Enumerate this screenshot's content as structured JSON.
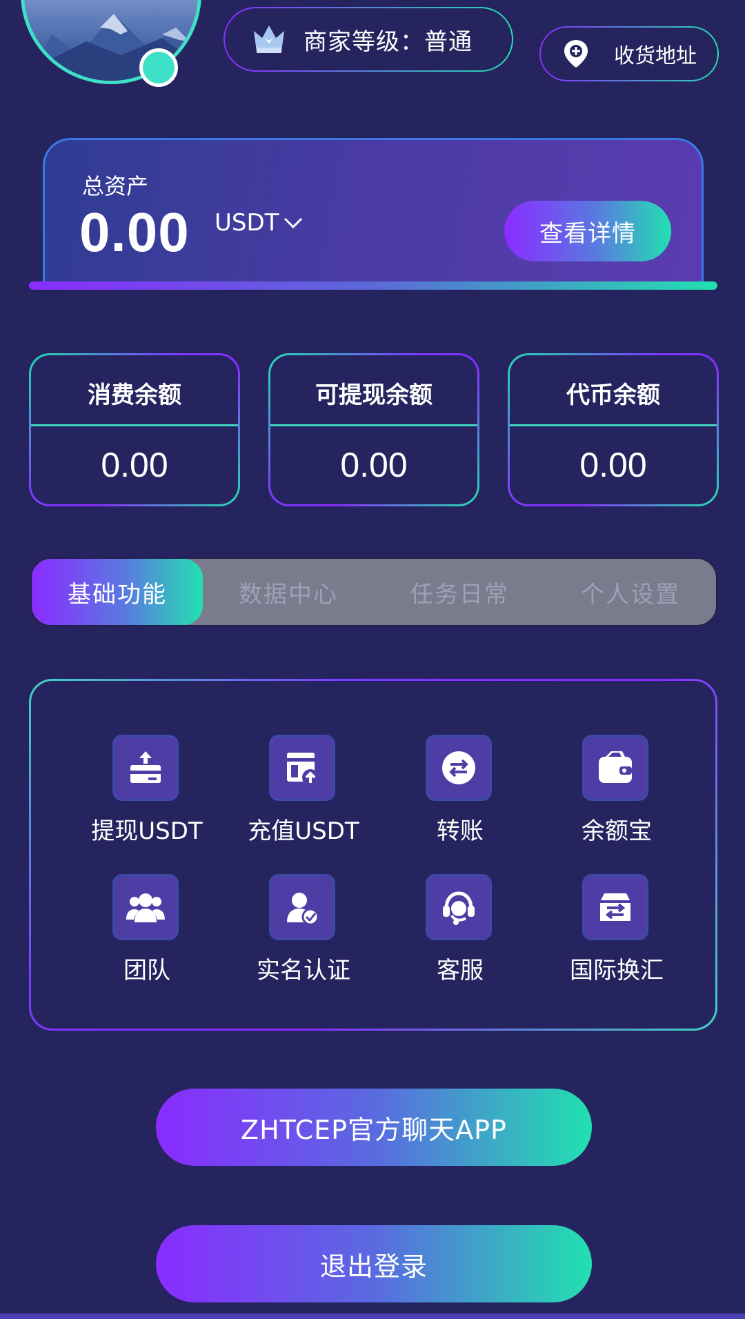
{
  "header": {
    "merchant_level_label": "商家等级：普通",
    "address_label": "收货地址"
  },
  "assets": {
    "title": "总资产",
    "value": "0.00",
    "unit": "USDT",
    "detail_button": "查看详情"
  },
  "balances": [
    {
      "title": "消费余额",
      "value": "0.00"
    },
    {
      "title": "可提现余额",
      "value": "0.00"
    },
    {
      "title": "代币余额",
      "value": "0.00"
    }
  ],
  "tabs": [
    {
      "label": "基础功能",
      "active": true
    },
    {
      "label": "数据中心",
      "active": false
    },
    {
      "label": "任务日常",
      "active": false
    },
    {
      "label": "个人设置",
      "active": false
    }
  ],
  "functions": [
    {
      "label": "提现USDT",
      "icon": "withdraw-icon"
    },
    {
      "label": "充值USDT",
      "icon": "recharge-icon"
    },
    {
      "label": "转账",
      "icon": "transfer-icon"
    },
    {
      "label": "余额宝",
      "icon": "wallet-icon"
    },
    {
      "label": "团队",
      "icon": "team-icon"
    },
    {
      "label": "实名认证",
      "icon": "verify-user-icon"
    },
    {
      "label": "客服",
      "icon": "customer-service-icon"
    },
    {
      "label": "国际换汇",
      "icon": "exchange-icon"
    }
  ],
  "buttons": {
    "chat_app": "ZHTCEP官方聊天APP",
    "logout": "退出登录"
  },
  "colors": {
    "background": "#26245f",
    "accent_purple": "#8a2cff",
    "accent_teal": "#22e0b0"
  }
}
